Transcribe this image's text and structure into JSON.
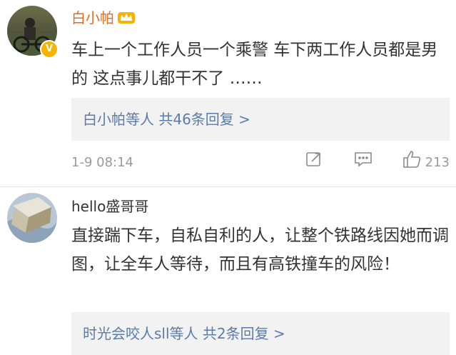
{
  "comments": [
    {
      "username": "白小帕",
      "text": "车上一个工作人员一个乘警 车下两工作人员都是男的 这点事儿都干不了 ……",
      "replies": {
        "prefix": "白小帕",
        "suffix": "等人 共46条回复 >"
      },
      "timestamp": "1-9 08:14",
      "likes": "213"
    },
    {
      "username": "hello盛哥哥",
      "text": "直接踹下车，自私自利的人，让整个铁路线因她而调图，让全车人等待，而且有高铁撞车的风险！",
      "replies": {
        "prefix": "时光会咬人sll",
        "suffix": "等人 共2条回复 >"
      }
    }
  ],
  "colors": {
    "vip_name": "#e86b1c",
    "link": "#5b7ca8",
    "meta": "#9a9a9a",
    "badge": "#f6b400"
  },
  "icons": [
    "verified-badge-icon",
    "vip-crown-icon",
    "forward-icon",
    "comment-icon",
    "like-icon"
  ]
}
